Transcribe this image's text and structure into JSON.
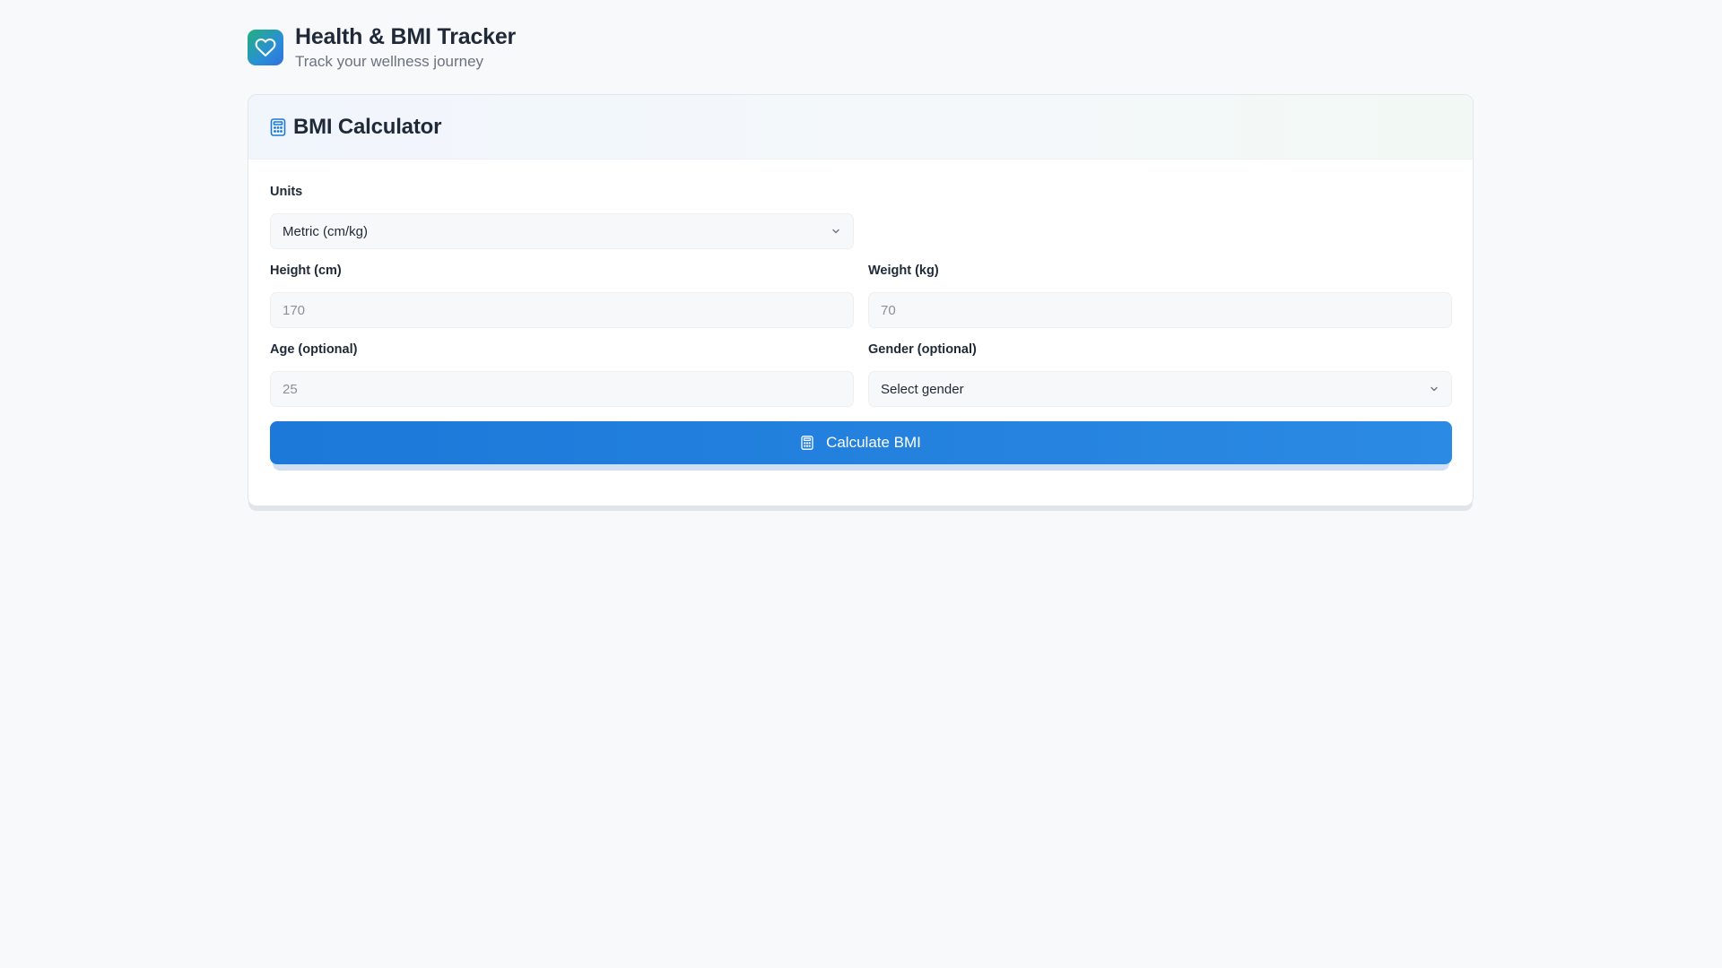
{
  "header": {
    "title": "Health & BMI Tracker",
    "subtitle": "Track your wellness journey",
    "logo_icon": "heart-icon"
  },
  "card": {
    "title": "BMI Calculator",
    "title_icon": "calculator-icon"
  },
  "form": {
    "units": {
      "label": "Units",
      "value": "Metric (cm/kg)"
    },
    "height": {
      "label": "Height (cm)",
      "placeholder": "170"
    },
    "weight": {
      "label": "Weight (kg)",
      "placeholder": "70"
    },
    "age": {
      "label": "Age (optional)",
      "placeholder": "25"
    },
    "gender": {
      "label": "Gender (optional)",
      "value": "Select gender"
    },
    "submit_label": "Calculate BMI"
  },
  "colors": {
    "primary": "#1c78d9",
    "logo_gradient_start": "#22b07d",
    "logo_gradient_end": "#2f6fe0",
    "background": "#f8f9fb"
  }
}
